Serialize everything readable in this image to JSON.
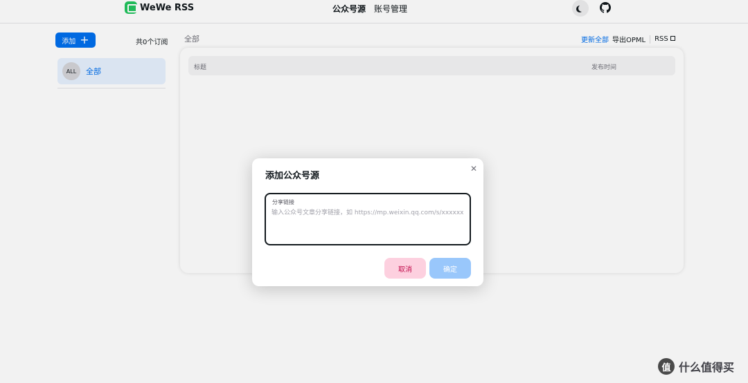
{
  "app": {
    "brand": "WeWe RSS",
    "nav": [
      {
        "label": "公众号源",
        "active": true
      },
      {
        "label": "账号管理",
        "active": false
      }
    ],
    "icons": {
      "theme": "moon-icon",
      "github": "github-icon"
    }
  },
  "sidebar": {
    "add_label": "添加",
    "subscription_count": "共0个订阅",
    "feeds": [
      {
        "avatar": "ALL",
        "label": "全部",
        "selected": true
      }
    ]
  },
  "main": {
    "title": "全部",
    "actions": {
      "update_all": "更新全部",
      "export_opml": "导出OPML",
      "rss": "RSS"
    },
    "table": {
      "columns": [
        "标题",
        "发布时间"
      ],
      "rows": []
    }
  },
  "modal": {
    "title": "添加公众号源",
    "field_label": "分享链接",
    "field_value": "",
    "field_placeholder": "输入公众号文章分享链接，如 https://mp.weixin.qq.com/s/xxxxxx",
    "cancel_label": "取消",
    "confirm_label": "确定"
  },
  "watermark": {
    "icon_text": "值",
    "text": "什么值得买"
  },
  "colors": {
    "primary": "#006fee",
    "selected_bg": "#e6f1fe",
    "cancel_bg": "#fdd0df",
    "cancel_text": "#c20e4d",
    "confirm_bg": "#99c7fb"
  }
}
